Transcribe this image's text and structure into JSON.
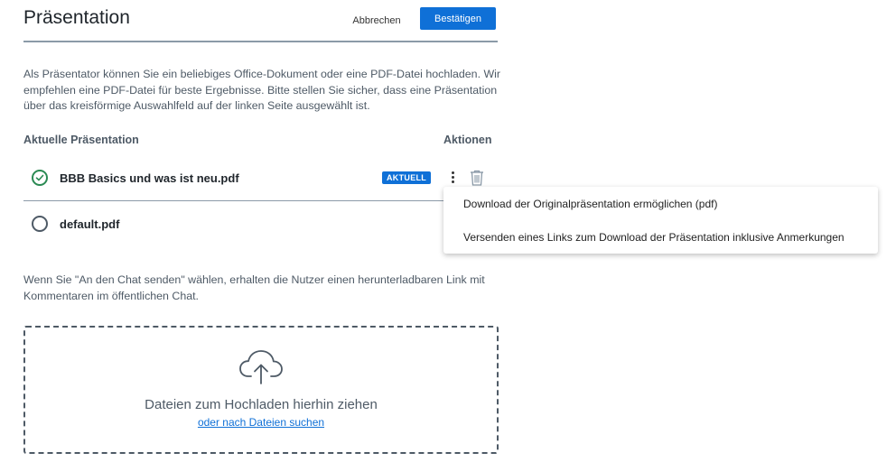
{
  "header": {
    "title": "Präsentation",
    "cancel_label": "Abbrechen",
    "confirm_label": "Bestätigen"
  },
  "intro_text": "Als Präsentator können Sie ein beliebiges Office-Dokument oder eine PDF-Datei hochladen. Wir empfehlen eine PDF-Datei für beste Ergebnisse. Bitte stellen Sie sicher, dass eine Präsentation über das kreisförmige Auswahlfeld auf der linken Seite ausgewählt ist.",
  "table": {
    "col_current": "Aktuelle Präsentation",
    "col_actions": "Aktionen",
    "rows": [
      {
        "name": "BBB Basics und was ist neu.pdf",
        "selected": true,
        "badge": "AKTUELL"
      },
      {
        "name": "default.pdf",
        "selected": false
      }
    ]
  },
  "menu": {
    "items": [
      {
        "label": "Download der Originalpräsentation ermöglichen (pdf)"
      },
      {
        "label": "Versenden eines Links zum Download der Präsentation inklusive Anmerkungen"
      }
    ]
  },
  "chat_note": "Wenn Sie \"An den Chat senden\" wählen, erhalten die Nutzer einen herunterladbaren Link mit Kommentaren im öffentlichen Chat.",
  "dropzone": {
    "text": "Dateien zum Hochladen hierhin ziehen",
    "link": "oder nach Dateien suchen"
  },
  "icons": {
    "selected": "check-circle-icon",
    "unselected": "radio-empty-icon",
    "more": "more-vertical-icon",
    "delete": "trash-icon",
    "upload": "cloud-upload-icon"
  },
  "colors": {
    "primary": "#0f70d7",
    "success": "#2b8a53",
    "text_muted": "#4e5a66"
  }
}
